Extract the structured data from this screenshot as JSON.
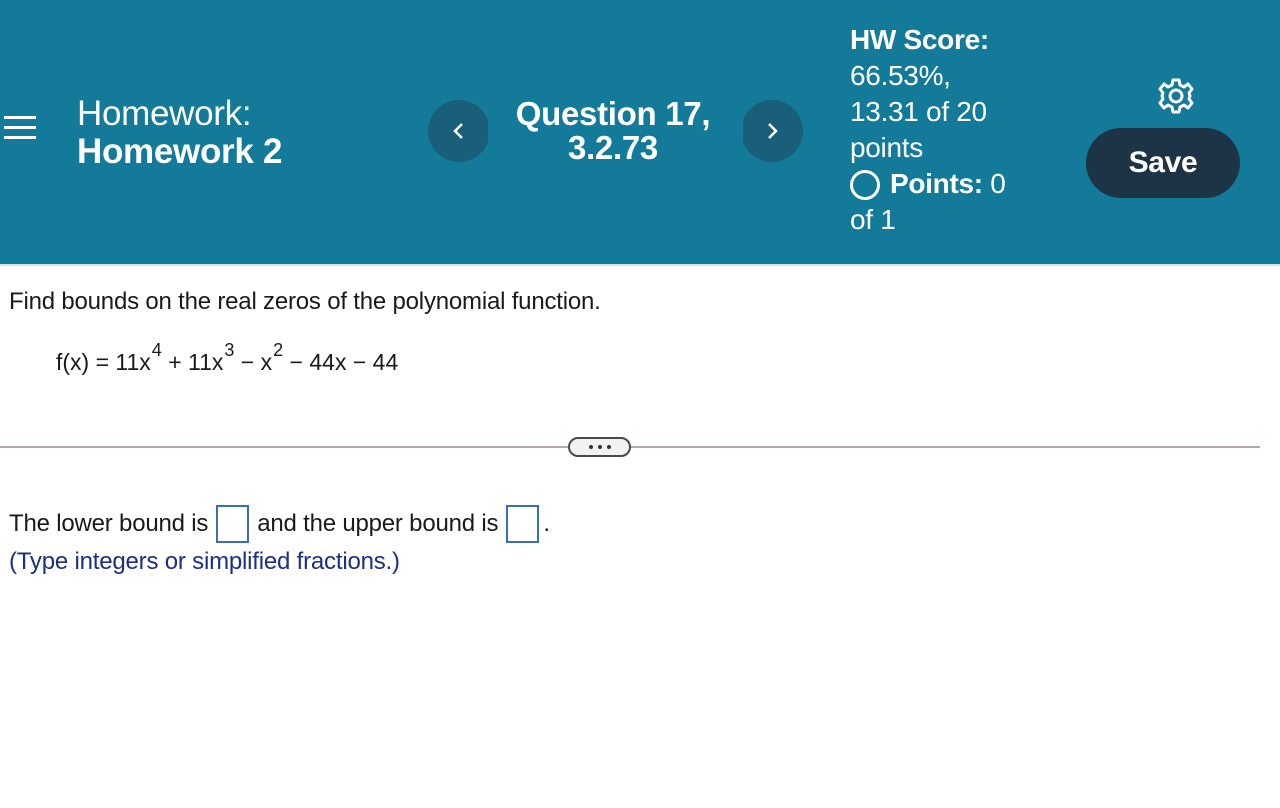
{
  "header": {
    "assignment_label": "Homework:",
    "assignment_name": "Homework 2",
    "question_title": "Question 17,",
    "question_number": "3.2.73",
    "prev_label": "<",
    "next_label": ">",
    "score_label": "HW Score:",
    "score_percent": "66.53%,",
    "score_points": "13.31 of 20",
    "score_points_unit": "points",
    "points_label": "Points:",
    "points_value": "0",
    "points_of": "of 1",
    "save_label": "Save",
    "colors": {
      "header_bg": "#137a99",
      "nav_button": "#1a5f7a",
      "save_button": "#1d3446"
    }
  },
  "question": {
    "prompt": "Find bounds on the real zeros of the polynomial function.",
    "equation": {
      "lhs": "f(x) = 11x",
      "exp4": "4",
      "t2": " + 11x",
      "exp3": "3",
      "t3": " − x",
      "exp2": "2",
      "t4": " − 44x − 44"
    },
    "more_label": "...",
    "answer_part1": "The lower bound is",
    "answer_part2": "and the upper bound is",
    "answer_end": ".",
    "lower_bound_value": "",
    "upper_bound_value": "",
    "hint": "(Type integers or simplified fractions.)"
  },
  "icons": {
    "menu": "hamburger-icon",
    "prev": "chevron-left-icon",
    "next": "chevron-right-icon",
    "points_status": "circle-outline-icon",
    "settings": "gear-icon"
  }
}
